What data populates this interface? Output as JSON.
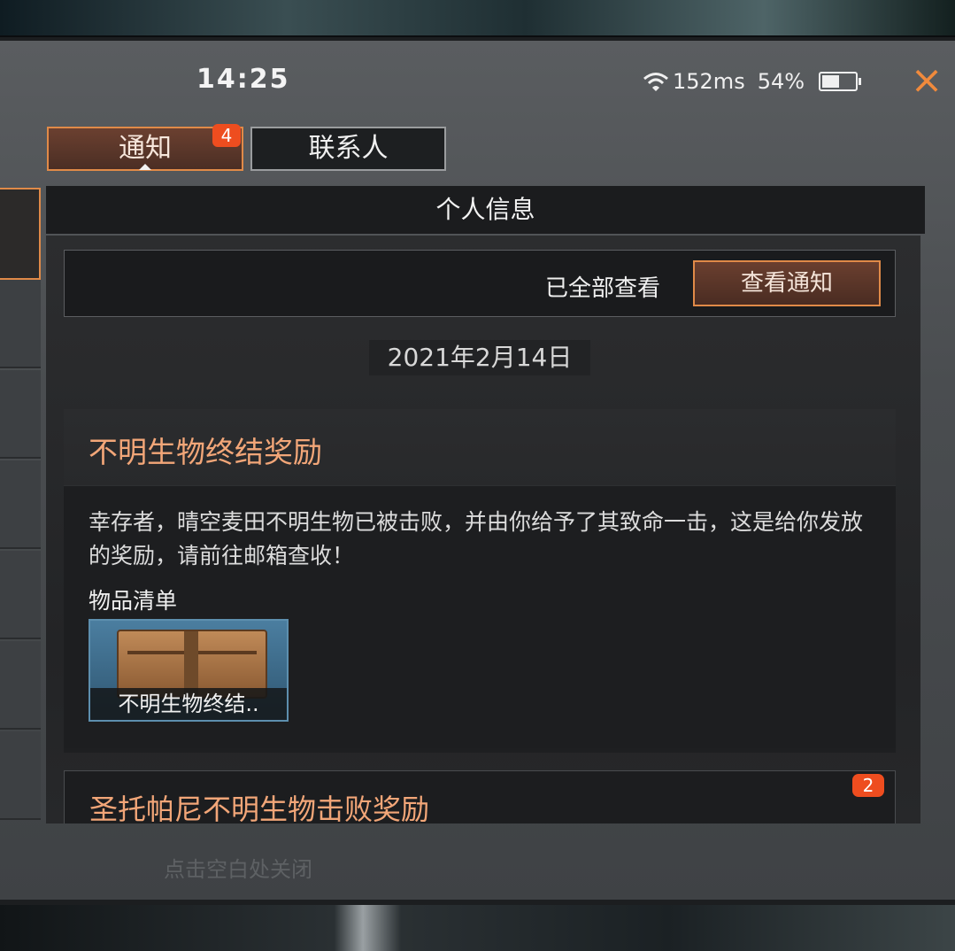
{
  "status_bar": {
    "time": "14:25",
    "ping": "152ms",
    "battery": "54%",
    "battery_level": 0.54,
    "icons": [
      "wifi-icon",
      "battery-icon"
    ]
  },
  "close_icon": "×",
  "tabs": [
    {
      "label": "通知",
      "badge": "4",
      "active": true
    },
    {
      "label": "联系人",
      "active": false
    }
  ],
  "panel": {
    "title": "个人信息",
    "viewed_all_text": "已全部查看",
    "view_notice_button": "查看通知",
    "date": "2021年2月14日"
  },
  "notifications": [
    {
      "title": "不明生物终结奖励",
      "body": "幸存者，晴空麦田不明生物已被击败，并由你给予了其致命一击，这是给你发放的奖励，请前往邮箱查收！",
      "items_label": "物品清单",
      "items": [
        {
          "name": "不明生物终结..",
          "icon": "chest-icon"
        }
      ]
    },
    {
      "title": "圣托帕尼不明生物击败奖励",
      "badge": "2"
    }
  ],
  "hint": "点击空白处关闭",
  "colors": {
    "accent": "#e08a48",
    "title_orange": "#f2a678",
    "badge_red": "#ee4d1f"
  }
}
